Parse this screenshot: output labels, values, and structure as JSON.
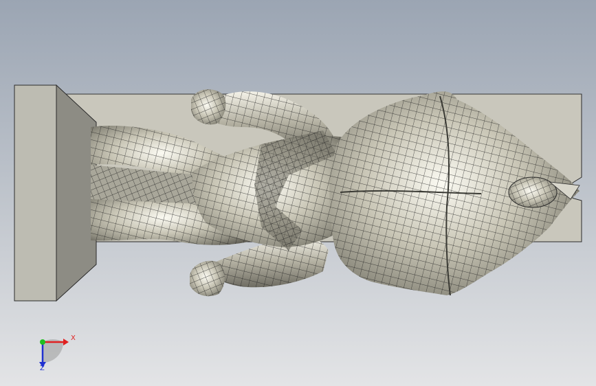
{
  "viewport": {
    "background_top": "#9ba5b3",
    "background_bottom": "#e3e4e6",
    "model_color": "#9a988b",
    "wire_color": "#1e1e1e"
  },
  "triad": {
    "x_label": "X",
    "z_label": "Z",
    "x_color": "#e02020",
    "y_color": "#20c020",
    "z_color": "#2030d0"
  }
}
